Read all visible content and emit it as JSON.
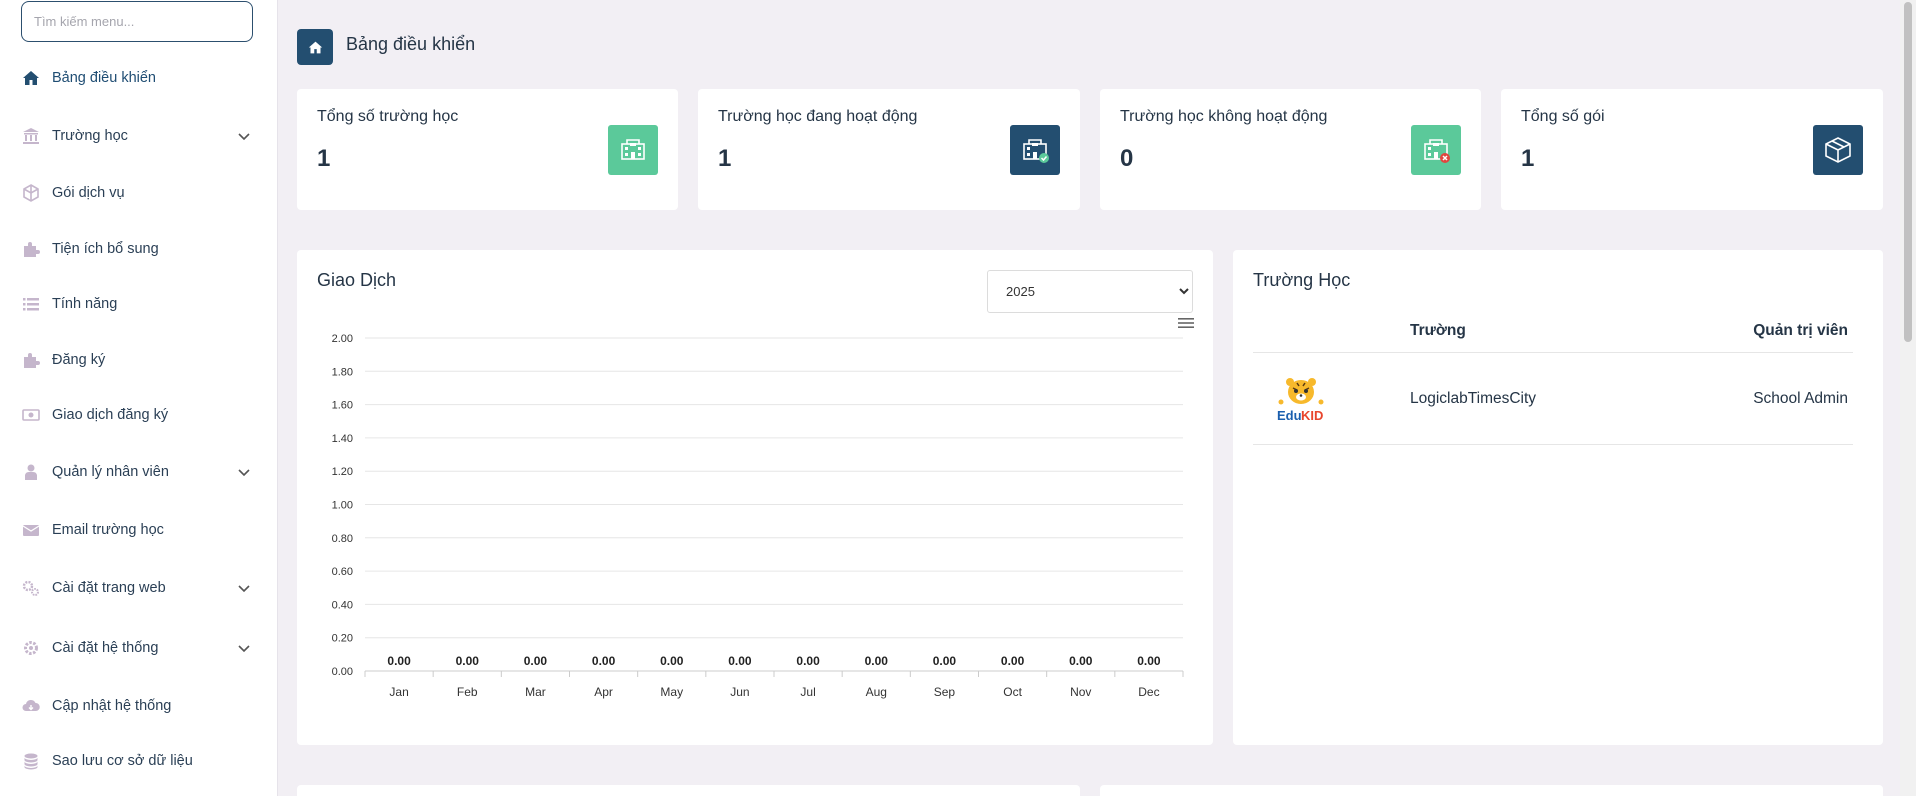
{
  "sidebar": {
    "search_placeholder": "Tìm kiếm menu...",
    "items": [
      {
        "label": "Bảng điều khiển",
        "icon": "home-icon",
        "active": true
      },
      {
        "label": "Trường học",
        "icon": "bank-icon",
        "has_submenu": true
      },
      {
        "label": "Gói dịch vụ",
        "icon": "cube-icon"
      },
      {
        "label": "Tiện ích bổ sung",
        "icon": "puzzle-icon"
      },
      {
        "label": "Tính năng",
        "icon": "list-icon"
      },
      {
        "label": "Đăng ký",
        "icon": "puzzle-icon"
      },
      {
        "label": "Giao dịch đăng ký",
        "icon": "money-icon"
      },
      {
        "label": "Quản lý nhân viên",
        "icon": "user-tie-icon",
        "has_submenu": true
      },
      {
        "label": "Email trường học",
        "icon": "envelope-icon"
      },
      {
        "label": "Cài đặt trang web",
        "icon": "gears-icon",
        "has_submenu": true
      },
      {
        "label": "Cài đặt hệ thống",
        "icon": "gear-icon",
        "has_submenu": true
      },
      {
        "label": "Cập nhật hệ thống",
        "icon": "cloud-download-icon"
      },
      {
        "label": "Sao lưu cơ sở dữ liệu",
        "icon": "database-icon"
      }
    ]
  },
  "header": {
    "title": "Bảng điều khiển"
  },
  "stats": [
    {
      "title": "Tổng số trường học",
      "value": "1",
      "icon": "school-icon",
      "color": "#5bc99a"
    },
    {
      "title": "Trường học đang hoạt động",
      "value": "1",
      "icon": "school-check-icon",
      "color": "#234e70"
    },
    {
      "title": "Trường học không hoạt động",
      "value": "0",
      "icon": "school-x-icon",
      "color": "#5bc99a"
    },
    {
      "title": "Tổng số gói",
      "value": "1",
      "icon": "package-icon",
      "color": "#234e70"
    }
  ],
  "transactions": {
    "title": "Giao Dịch",
    "year_selected": "2025"
  },
  "chart_data": {
    "type": "bar",
    "categories": [
      "Jan",
      "Feb",
      "Mar",
      "Apr",
      "May",
      "Jun",
      "Jul",
      "Aug",
      "Sep",
      "Oct",
      "Nov",
      "Dec"
    ],
    "values": [
      0,
      0,
      0,
      0,
      0,
      0,
      0,
      0,
      0,
      0,
      0,
      0
    ],
    "data_labels": [
      "0.00",
      "0.00",
      "0.00",
      "0.00",
      "0.00",
      "0.00",
      "0.00",
      "0.00",
      "0.00",
      "0.00",
      "0.00",
      "0.00"
    ],
    "y_ticks": [
      "0.00",
      "0.20",
      "0.40",
      "0.60",
      "0.80",
      "1.00",
      "1.20",
      "1.40",
      "1.60",
      "1.80",
      "2.00"
    ],
    "ylim": [
      0,
      2
    ],
    "grid": true,
    "title": "",
    "xlabel": "",
    "ylabel": ""
  },
  "schools": {
    "title": "Trường Học",
    "columns": [
      "Trường",
      "Quản trị viên"
    ],
    "rows": [
      {
        "name": "LogiclabTimesCity",
        "admin": "School Admin",
        "logo_text": "EduKID"
      }
    ]
  },
  "colors": {
    "primary": "#234e70",
    "green": "#5bc99a",
    "background": "#f2eff4",
    "sidebar_icon": "#c5b6cc"
  }
}
